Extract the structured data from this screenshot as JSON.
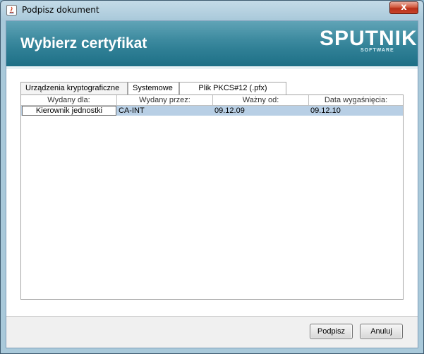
{
  "window": {
    "title": "Podpisz dokument",
    "close_symbol": "x"
  },
  "banner": {
    "title": "Wybierz certyfikat",
    "logo_text": "SPUTNIK",
    "logo_subtext": "SOFTWARE"
  },
  "tabs": [
    {
      "label": "Urządzenia kryptograficzne"
    },
    {
      "label": "Systemowe"
    },
    {
      "label": "Plik PKCS#12 (.pfx)"
    }
  ],
  "table": {
    "columns": [
      "Wydany dla:",
      "Wydany przez:",
      "Ważny od:",
      "Data wygaśnięcia:"
    ],
    "rows": [
      [
        "Kierownik jednostki",
        "CA-INT",
        "09.12.09",
        "09.12.10"
      ]
    ]
  },
  "buttons": {
    "sign": "Podpisz",
    "cancel": "Anuluj"
  },
  "colors": {
    "banner": "#2a7f96",
    "selected_row": "#b8cfe5",
    "close_button": "#c8462b"
  }
}
